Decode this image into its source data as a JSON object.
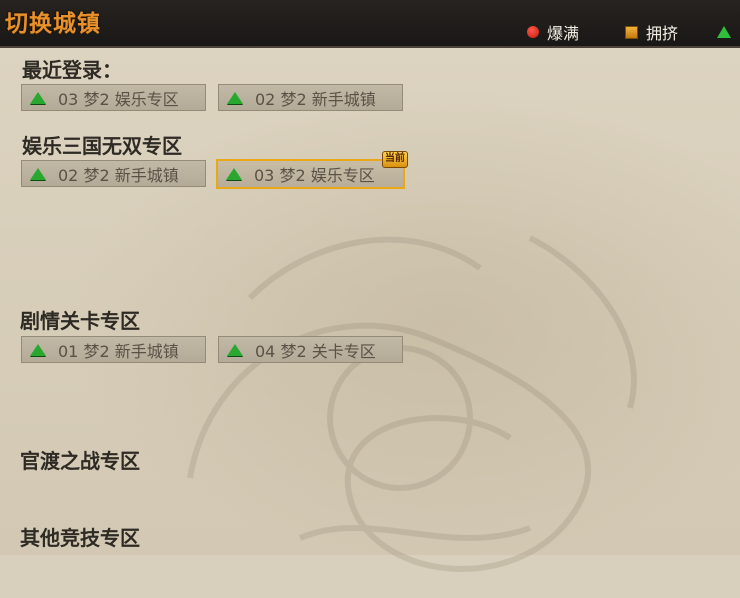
{
  "header": {
    "title": "切换城镇",
    "legend": [
      {
        "icon": "red-dot-icon",
        "label": "爆满",
        "color": "#d42a1c"
      },
      {
        "icon": "orange-square-icon",
        "label": "拥挤",
        "color": "#e39a20"
      },
      {
        "icon": "green-triangle-icon",
        "label": "",
        "color": "#2fbf3a"
      }
    ]
  },
  "sections": {
    "recent": {
      "title": "最近登录：",
      "servers": [
        {
          "name": "03 梦2 娱乐专区"
        },
        {
          "name": "02 梦2 新手城镇"
        }
      ]
    },
    "entertainment": {
      "title": "娱乐三国无双专区",
      "servers": [
        {
          "name": "02 梦2 新手城镇"
        },
        {
          "name": "03 梦2 娱乐专区",
          "badge": "当前"
        }
      ]
    },
    "story": {
      "title": "剧情关卡专区",
      "servers": [
        {
          "name": "01 梦2 新手城镇"
        },
        {
          "name": "04 梦2 关卡专区"
        }
      ]
    },
    "guandu": {
      "title": "官渡之战专区"
    },
    "other": {
      "title": "其他竞技专区"
    }
  }
}
